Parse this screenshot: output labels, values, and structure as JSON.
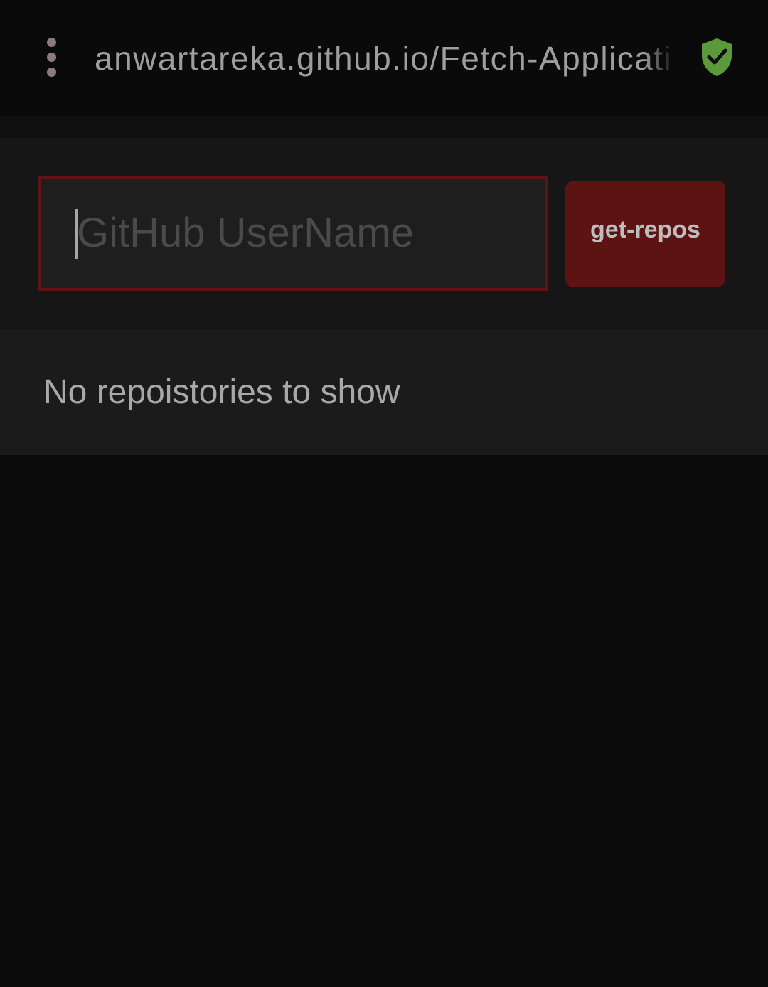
{
  "browser": {
    "url": "anwartareka.github.io/Fetch-Application",
    "menu_icon": "vertical-ellipsis-icon",
    "security_icon": "shield-check-icon",
    "security_color": "#5a9a3c"
  },
  "form": {
    "username_placeholder": "GitHub UserName",
    "username_value": "",
    "submit_label": "get-repos"
  },
  "results": {
    "empty_message": "No repoistories to show"
  },
  "colors": {
    "accent": "#5e1313",
    "input_border": "#5c1414",
    "background": "#0b0b0b"
  }
}
